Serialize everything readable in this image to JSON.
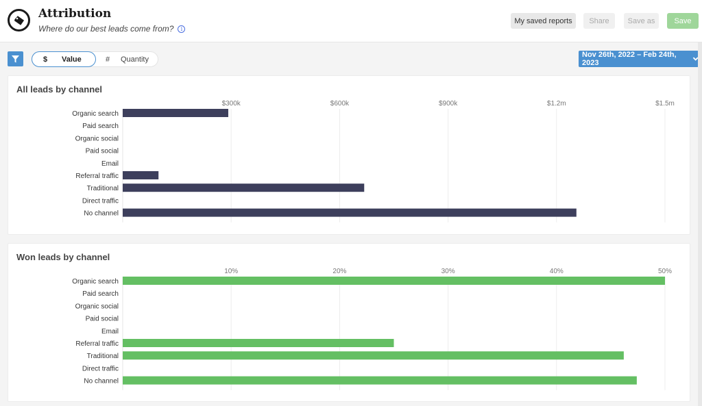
{
  "header": {
    "title": "Attribution",
    "subtitle": "Where do our best leads come from?",
    "logo_icon": "price-tag-icon",
    "info_icon": "i"
  },
  "toolbar": {
    "saved_reports_label": "My saved reports",
    "share_label": "Share",
    "save_as_label": "Save as",
    "save_label": "Save"
  },
  "controls": {
    "filter_icon": "funnel-icon",
    "toggle": {
      "value": {
        "symbol": "$",
        "label": "Value",
        "selected": true
      },
      "quantity": {
        "symbol": "#",
        "label": "Quantity",
        "selected": false
      }
    },
    "date_range": "Nov 26th, 2022 – Feb 24th, 2023"
  },
  "colors": {
    "accent": "#4a90d0",
    "bar_all": "#3d3f5c",
    "bar_won": "#64bf63",
    "save_disabled": "#9fd69a"
  },
  "chart_data": [
    {
      "type": "bar",
      "orientation": "horizontal",
      "title": "All leads by channel",
      "categories": [
        "Organic search",
        "Paid search",
        "Organic social",
        "Paid social",
        "Email",
        "Referral traffic",
        "Traditional",
        "Direct traffic",
        "No channel"
      ],
      "values": [
        292000,
        0,
        0,
        0,
        0,
        99000,
        668000,
        0,
        1255000
      ],
      "xlim": [
        0,
        1500000
      ],
      "ticks": [
        300000,
        600000,
        900000,
        1200000,
        1500000
      ],
      "tick_labels": [
        "$300k",
        "$600k",
        "$900k",
        "$1.2m",
        "$1.5m"
      ],
      "xlabel": "",
      "ylabel": "",
      "grid": true,
      "color": "#3d3f5c"
    },
    {
      "type": "bar",
      "orientation": "horizontal",
      "title": "Won leads by channel",
      "categories": [
        "Organic search",
        "Paid search",
        "Organic social",
        "Paid social",
        "Email",
        "Referral traffic",
        "Traditional",
        "Direct traffic",
        "No channel"
      ],
      "values": [
        50,
        0,
        0,
        0,
        0,
        25,
        46.2,
        0,
        47.4
      ],
      "xlim": [
        0,
        50
      ],
      "ticks": [
        10,
        20,
        30,
        40,
        50
      ],
      "tick_labels": [
        "10%",
        "20%",
        "30%",
        "40%",
        "50%"
      ],
      "xlabel": "",
      "ylabel": "",
      "grid": true,
      "color": "#64bf63"
    }
  ]
}
